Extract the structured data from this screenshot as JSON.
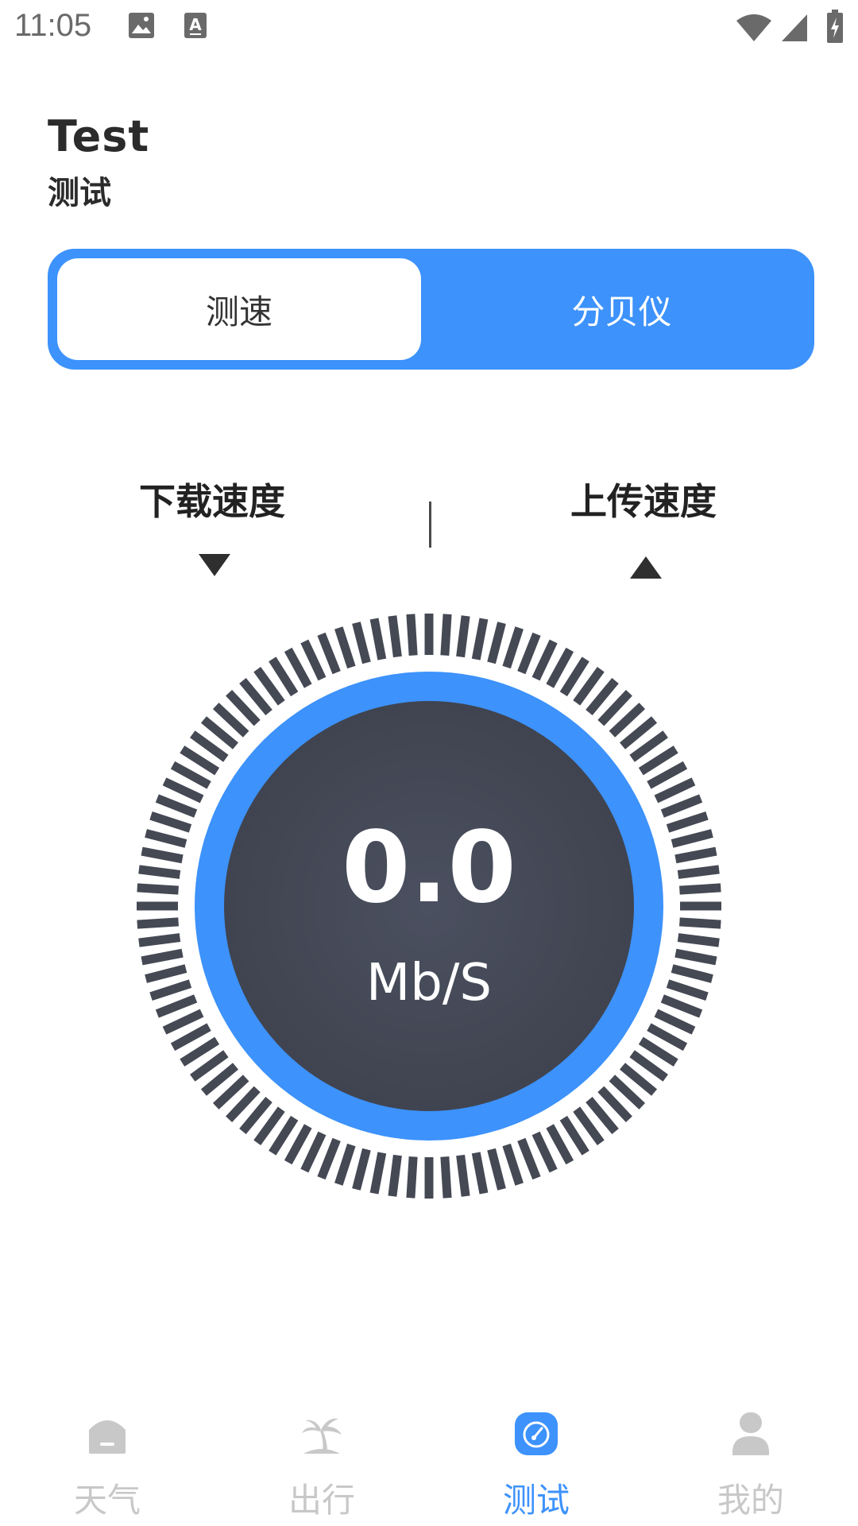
{
  "status_bar": {
    "time": "11:05"
  },
  "header": {
    "title_en": "Test",
    "title_zh": "测试"
  },
  "tabs": [
    {
      "label": "测速",
      "active": true
    },
    {
      "label": "分贝仪",
      "active": false
    }
  ],
  "speed": {
    "download_label": "下载速度",
    "upload_label": "上传速度",
    "value": "0.0",
    "unit": "Mb/S"
  },
  "bottom_nav": [
    {
      "label": "天气",
      "icon": "weather-home-icon",
      "active": false
    },
    {
      "label": "出行",
      "icon": "palm-tree-icon",
      "active": false
    },
    {
      "label": "测试",
      "icon": "speedometer-icon",
      "active": true
    },
    {
      "label": "我的",
      "icon": "person-icon",
      "active": false
    }
  ],
  "colors": {
    "accent": "#3d92fb",
    "gauge_dark": "#454954",
    "nav_inactive": "#c8c8c8"
  }
}
